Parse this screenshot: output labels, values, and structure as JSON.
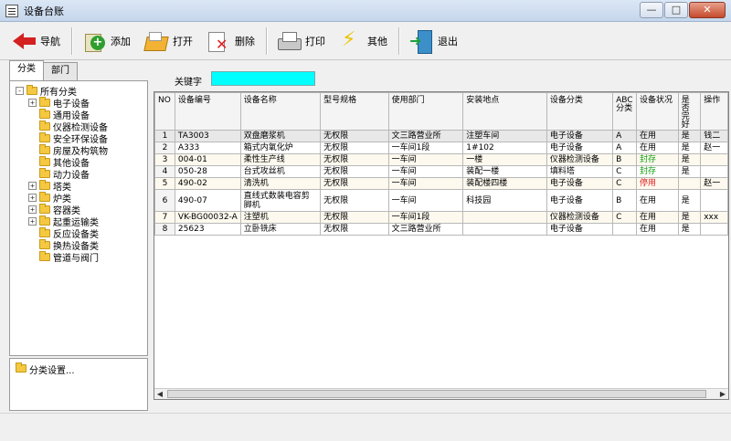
{
  "window": {
    "title": "设备台账"
  },
  "toolbar": {
    "back": "导航",
    "add": "添加",
    "open": "打开",
    "delete": "删除",
    "print": "打印",
    "other": "其他",
    "exit": "退出"
  },
  "tabs": [
    "分类",
    "部门"
  ],
  "tree": [
    {
      "label": "所有分类",
      "level": 0,
      "expander": "-"
    },
    {
      "label": "电子设备",
      "level": 1,
      "expander": "+"
    },
    {
      "label": "通用设备",
      "level": 1,
      "expander": ""
    },
    {
      "label": "仪器检测设备",
      "level": 1,
      "expander": ""
    },
    {
      "label": "安全环保设备",
      "level": 1,
      "expander": ""
    },
    {
      "label": "房屋及构筑物",
      "level": 1,
      "expander": ""
    },
    {
      "label": "其他设备",
      "level": 1,
      "expander": ""
    },
    {
      "label": "动力设备",
      "level": 1,
      "expander": ""
    },
    {
      "label": "塔类",
      "level": 1,
      "expander": "+"
    },
    {
      "label": "炉类",
      "level": 1,
      "expander": "+"
    },
    {
      "label": "容器类",
      "level": 1,
      "expander": "+"
    },
    {
      "label": "起重运输类",
      "level": 1,
      "expander": "+"
    },
    {
      "label": "反应设备类",
      "level": 1,
      "expander": ""
    },
    {
      "label": "换热设备类",
      "level": 1,
      "expander": ""
    },
    {
      "label": "管道与阀门",
      "level": 1,
      "expander": ""
    }
  ],
  "settings_label": "分类设置...",
  "search": {
    "label": "关键字",
    "value": ""
  },
  "table": {
    "columns": [
      "NO",
      "设备编号",
      "设备名称",
      "型号规格",
      "使用部门",
      "安装地点",
      "设备分类",
      "ABC分类",
      "设备状况",
      "是否完好",
      "操作"
    ],
    "rows": [
      [
        "1",
        "TA3003",
        "双盘磨浆机",
        "无权限",
        "文三路营业所",
        "注塑车间",
        "电子设备",
        "A",
        "在用",
        "是",
        "钱二"
      ],
      [
        "2",
        "A333",
        "箱式内氧化炉",
        "无权限",
        "一车间1段",
        "1#102",
        "电子设备",
        "A",
        "在用",
        "是",
        "赵一"
      ],
      [
        "3",
        "004-01",
        "柔性生产线",
        "无权限",
        "一车间",
        "一楼",
        "仪器检测设备",
        "B",
        "封存",
        "是",
        ""
      ],
      [
        "4",
        "050-28",
        "台式攻丝机",
        "无权限",
        "一车间",
        "装配一楼",
        "填料塔",
        "C",
        "封存",
        "是",
        ""
      ],
      [
        "5",
        "490-02",
        "清洗机",
        "无权限",
        "一车间",
        "装配楼四楼",
        "电子设备",
        "C",
        "停用",
        "",
        "赵一"
      ],
      [
        "6",
        "490-07",
        "直线式数装电容剪脚机",
        "无权限",
        "一车间",
        "科技园",
        "电子设备",
        "B",
        "在用",
        "是",
        ""
      ],
      [
        "7",
        "VK-BG00032-A",
        "注塑机",
        "无权限",
        "一车间1段",
        "",
        "仪器检测设备",
        "C",
        "在用",
        "是",
        "xxx"
      ],
      [
        "8",
        "25623",
        "立卧铣床",
        "无权限",
        "文三路营业所",
        "",
        "电子设备",
        "",
        "在用",
        "是",
        ""
      ]
    ],
    "status_colors": {
      "封存": "#10a010",
      "停用": "#e02020"
    }
  },
  "window_buttons": {
    "minimize": "—",
    "maximize": "□",
    "close": "✕"
  }
}
